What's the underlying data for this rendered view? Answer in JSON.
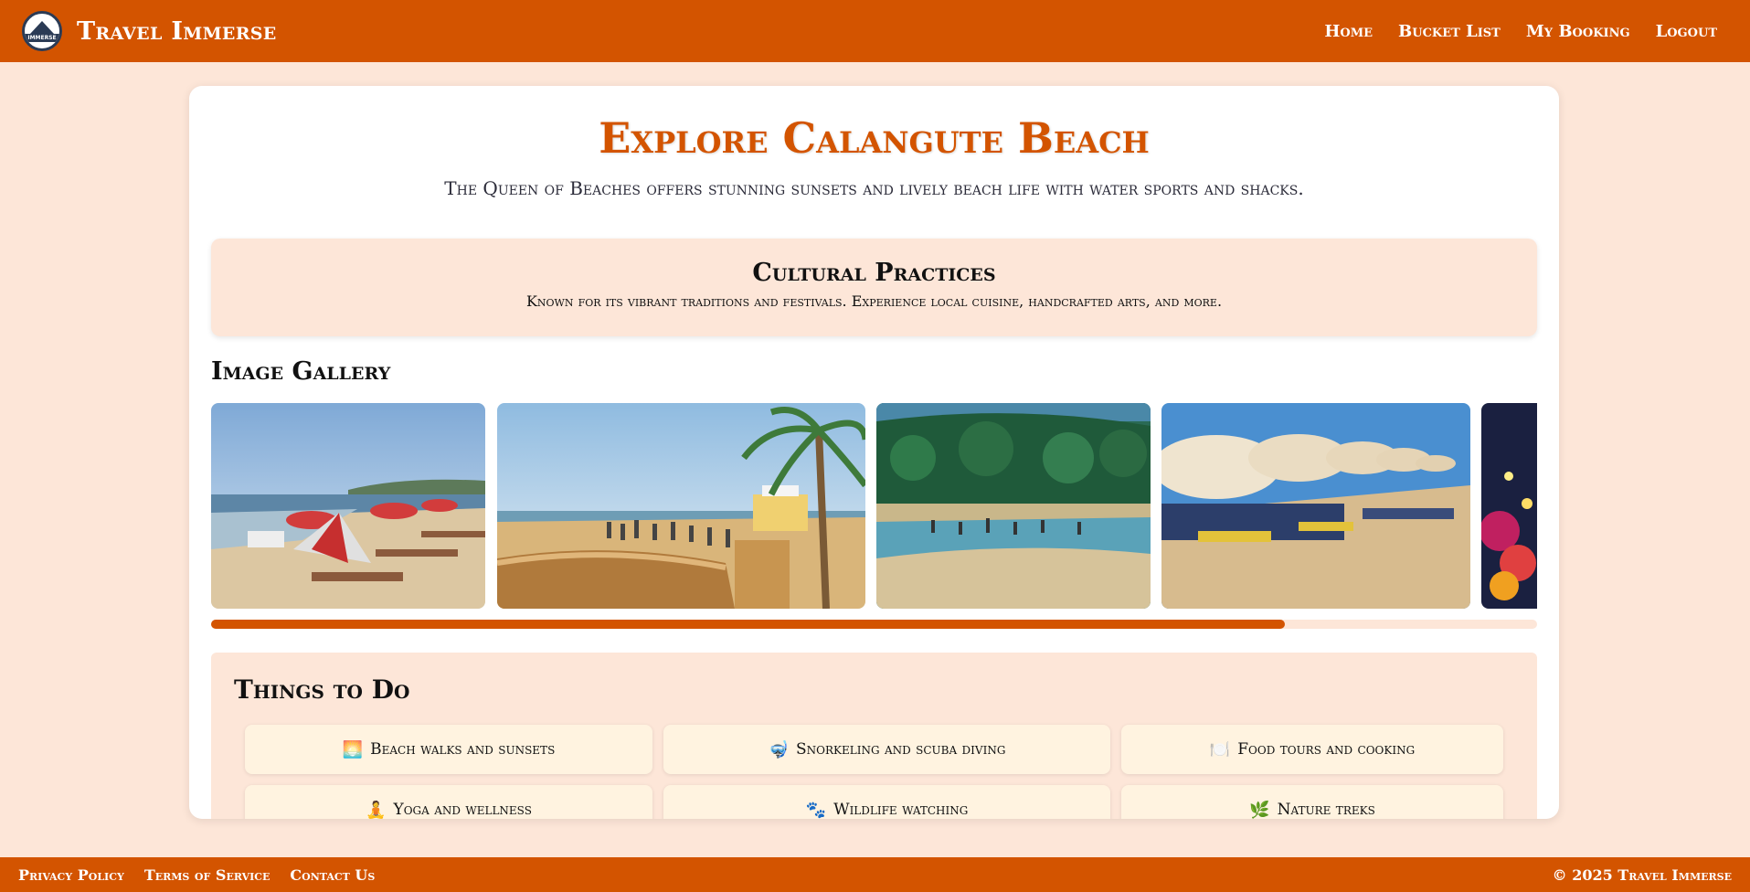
{
  "header": {
    "logo_text": "IMMERSE",
    "brand": "Travel Immerse",
    "nav": [
      "Home",
      "Bucket List",
      "My Booking",
      "Logout"
    ]
  },
  "main": {
    "title": "Explore Calangute Beach",
    "subtitle": "The Queen of Beaches offers stunning sunsets and lively beach life with water sports and shacks.",
    "culture": {
      "heading": "Cultural Practices",
      "text": "Known for its vibrant traditions and festivals. Experience local cuisine, handcrafted arts, and more."
    },
    "gallery": {
      "heading": "Image Gallery",
      "scroll_progress": 0.81
    },
    "things_to_do": {
      "heading": "Things to Do",
      "items": [
        {
          "icon": "🌅",
          "label": "Beach walks and sunsets"
        },
        {
          "icon": "🤿",
          "label": "Snorkeling and scuba diving"
        },
        {
          "icon": "🍽️",
          "label": "Food tours and cooking"
        },
        {
          "icon": "🧘",
          "label": "Yoga and wellness"
        },
        {
          "icon": "🐾",
          "label": "Wildlife watching"
        },
        {
          "icon": "🌿",
          "label": "Nature treks"
        }
      ]
    }
  },
  "footer": {
    "links": [
      "Privacy Policy",
      "Terms of Service",
      "Contact Us"
    ],
    "copyright": "© 2025 Travel Immerse"
  },
  "colors": {
    "accent": "#d35400",
    "page_bg": "#fde6d8",
    "card_bg": "#ffffff",
    "activity_bg": "#fff3e0"
  }
}
